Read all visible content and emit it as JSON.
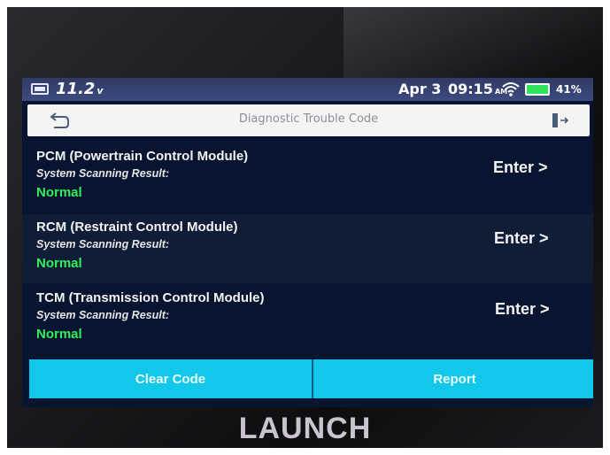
{
  "statusbar": {
    "voltage": "11.2",
    "voltage_unit": "v",
    "date": "Apr 3",
    "time": "09:15",
    "ampm": "AM",
    "battery_pct": "41%",
    "battery_color": "#2fe35a"
  },
  "titlebar": {
    "title": "Diagnostic Trouble Code",
    "back_icon": "back-arrow-icon",
    "exit_icon": "exit-icon"
  },
  "modules": [
    {
      "name": "PCM (Powertrain Control Module)",
      "result_label": "System Scanning Result:",
      "status": "Normal",
      "enter_label": "Enter >"
    },
    {
      "name": "RCM (Restraint Control Module)",
      "result_label": "System Scanning Result:",
      "status": "Normal",
      "enter_label": "Enter >"
    },
    {
      "name": "TCM (Transmission Control Module)",
      "result_label": "System Scanning Result:",
      "status": "Normal",
      "enter_label": "Enter >"
    }
  ],
  "footer": {
    "clear_code_label": "Clear Code",
    "report_label": "Report"
  },
  "brand": "LAUNCH",
  "colors": {
    "accent": "#12c7ea",
    "status_normal": "#2ff05a",
    "screen_bg": "#071530"
  }
}
